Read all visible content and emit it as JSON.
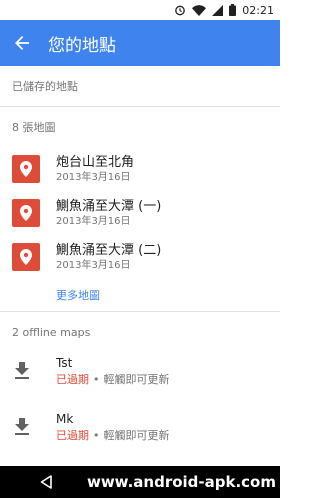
{
  "status_bar": {
    "time": "02:21"
  },
  "app_bar": {
    "title": "您的地點"
  },
  "sections": {
    "saved": "已儲存的地點",
    "maps": "8 張地圖",
    "offline": "2 offline maps"
  },
  "maps": [
    {
      "title": "炮台山至北角",
      "date": "2013年3月16日"
    },
    {
      "title": "鰂魚涌至大潭 (一)",
      "date": "2013年3月16日"
    },
    {
      "title": "鰂魚涌至大潭 (二)",
      "date": "2013年3月16日"
    }
  ],
  "more_maps": "更多地圖",
  "offline_maps": [
    {
      "title": "Tst",
      "status": "已過期",
      "hint": "輕觸即可更新"
    },
    {
      "title": "Mk",
      "status": "已過期",
      "hint": "輕觸即可更新"
    }
  ],
  "watermark": "www.android-apk.com",
  "colors": {
    "app_bar": "#3f84ee",
    "pin": "#dd4b39",
    "expired": "#dd4b39",
    "link": "#3f84ee"
  },
  "icons": [
    "alarm-icon",
    "wifi-icon",
    "signal-icon",
    "battery-icon",
    "back-arrow-icon",
    "map-pin-icon",
    "download-icon",
    "nav-back-icon"
  ]
}
